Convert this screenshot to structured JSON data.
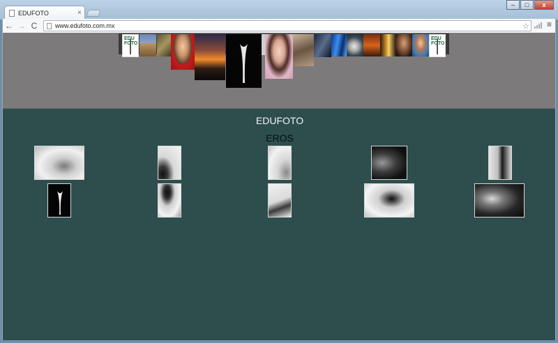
{
  "browser": {
    "tab_title": "EDUFOTO",
    "tab_close": "×",
    "url": "www.edufoto.com.mx",
    "back": "←",
    "forward": "→",
    "reload": "C",
    "star": "☆",
    "menu": "≡",
    "minimize": "–",
    "maximize": "□",
    "close": "x"
  },
  "banner": {
    "logo_text": "EDU FOTO"
  },
  "page": {
    "site_title": "EDUFOTO",
    "section_title": "EROS"
  },
  "gallery": {
    "item_count": 10
  }
}
